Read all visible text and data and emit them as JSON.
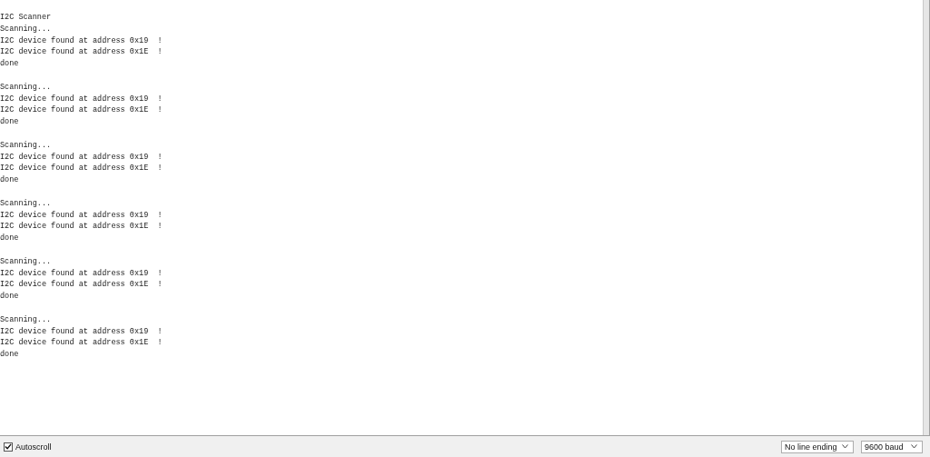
{
  "output": {
    "blocks": [
      [
        "I2C Scanner",
        "Scanning...",
        "I2C device found at address 0x19  !",
        "I2C device found at address 0x1E  !",
        "done"
      ],
      [
        "Scanning...",
        "I2C device found at address 0x19  !",
        "I2C device found at address 0x1E  !",
        "done"
      ],
      [
        "Scanning...",
        "I2C device found at address 0x19  !",
        "I2C device found at address 0x1E  !",
        "done"
      ],
      [
        "Scanning...",
        "I2C device found at address 0x19  !",
        "I2C device found at address 0x1E  !",
        "done"
      ],
      [
        "Scanning...",
        "I2C device found at address 0x19  !",
        "I2C device found at address 0x1E  !",
        "done"
      ],
      [
        "Scanning...",
        "I2C device found at address 0x19  !",
        "I2C device found at address 0x1E  !",
        "done"
      ]
    ]
  },
  "footer": {
    "autoscroll": {
      "label": "Autoscroll",
      "checked": true
    },
    "line_ending": "No line ending",
    "baud": "9600 baud"
  }
}
